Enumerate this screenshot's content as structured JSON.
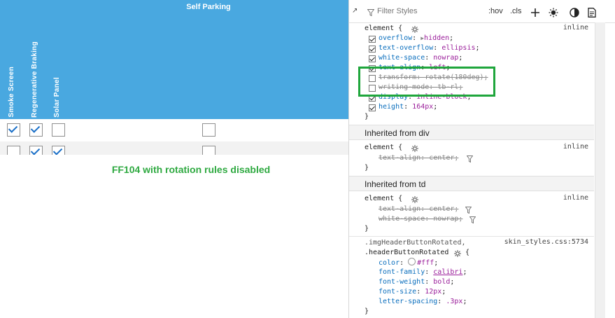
{
  "table": {
    "header_title": "Self Parking",
    "columns": [
      "Smoke Screen",
      "Regenerative Braking",
      "Solar Panel"
    ],
    "rows": [
      {
        "smoke_screen": true,
        "regenerative_braking": true,
        "solar_panel": false,
        "self_parking": false
      },
      {
        "smoke_screen": false,
        "regenerative_braking": true,
        "solar_panel": true,
        "self_parking": false
      }
    ],
    "header_color": "#49a8e0"
  },
  "caption": "FF104 with rotation rules disabled",
  "devtools": {
    "toolbar": {
      "filter_placeholder": "Filter Styles",
      "hov": ":hov",
      "cls": ".cls"
    },
    "element_rule": {
      "selector": "element {",
      "source": "inline",
      "declarations": [
        {
          "prop": "overflow",
          "value": "hidden",
          "enabled": true,
          "arrow": true
        },
        {
          "prop": "text-overflow",
          "value": "ellipsis",
          "enabled": true
        },
        {
          "prop": "white-space",
          "value": "nowrap",
          "enabled": true
        },
        {
          "prop": "text-align",
          "value": "left",
          "enabled": true
        },
        {
          "prop": "transform",
          "value": "rotate(180deg)",
          "enabled": false
        },
        {
          "prop": "writing-mode",
          "value": "tb-rl",
          "enabled": false
        },
        {
          "prop": "display",
          "value": "inline-block",
          "enabled": true
        },
        {
          "prop": "height",
          "value": "164px",
          "enabled": true
        }
      ],
      "close": "}"
    },
    "inherited_div": {
      "label": "Inherited from div",
      "selector": "element {",
      "source": "inline",
      "declarations": [
        {
          "prop": "text-align",
          "value": "center"
        }
      ],
      "close": "}"
    },
    "inherited_td": {
      "label": "Inherited from td",
      "selector": "element {",
      "source": "inline",
      "declarations": [
        {
          "prop": "text-align",
          "value": "center"
        },
        {
          "prop": "white-space",
          "value": "nowrap"
        }
      ],
      "close": "}"
    },
    "class_rule": {
      "selector_1": ".imgHeaderButtonRotated,",
      "selector_2": ".headerButtonRotated",
      "brace": "{",
      "source": "skin_styles.css:5734",
      "declarations": [
        {
          "prop": "color",
          "value": "#fff"
        },
        {
          "prop": "font-family",
          "value": "calibri"
        },
        {
          "prop": "font-weight",
          "value": "bold"
        },
        {
          "prop": "font-size",
          "value": "12px"
        },
        {
          "prop": "letter-spacing",
          "value": ".3px"
        }
      ],
      "close": "}"
    },
    "highlight_color": "#1fa63c"
  }
}
